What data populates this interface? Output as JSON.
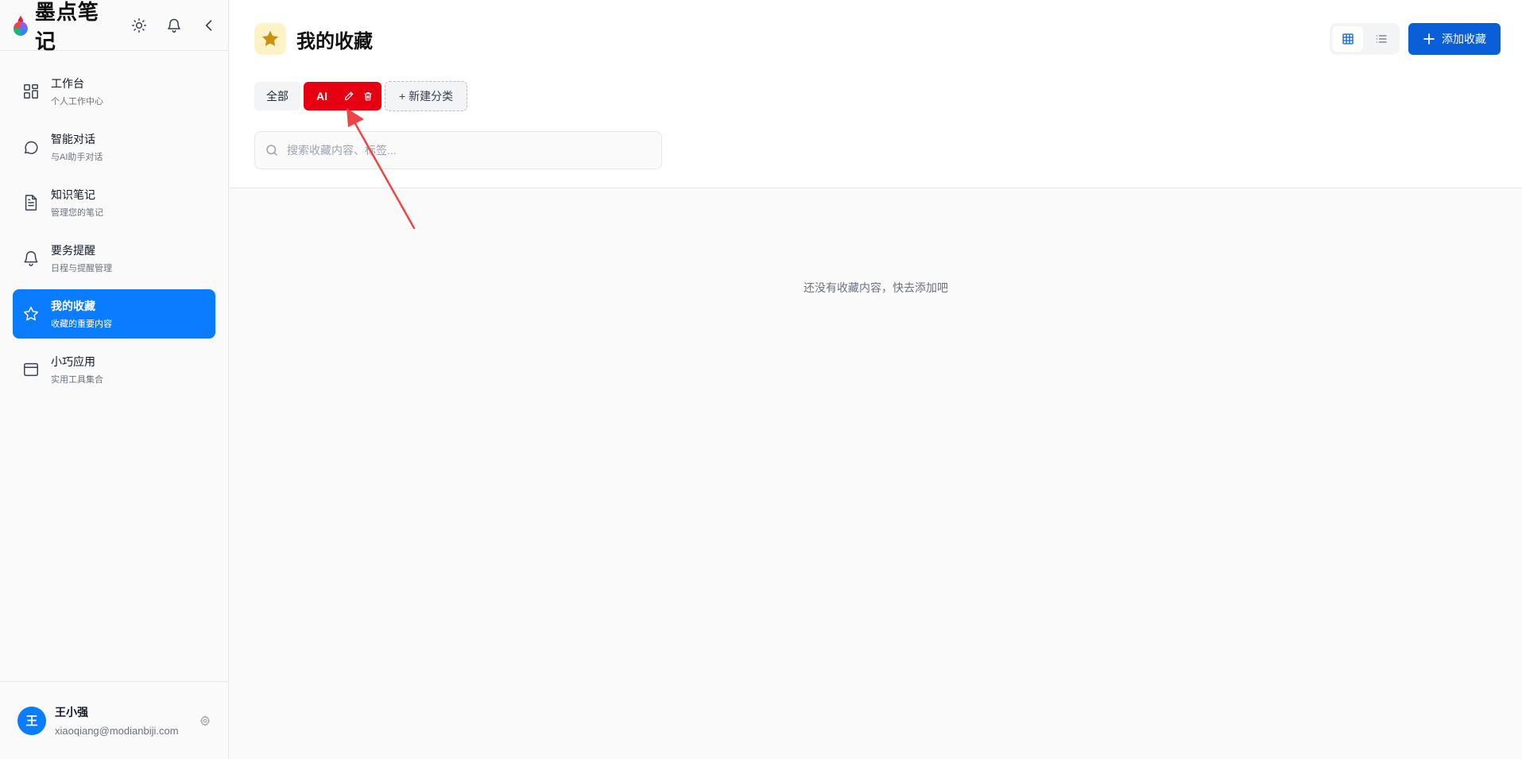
{
  "brand": {
    "name": "墨点笔记"
  },
  "nav": {
    "items": [
      {
        "title": "工作台",
        "sub": "个人工作中心",
        "icon": "dashboard-icon"
      },
      {
        "title": "智能对话",
        "sub": "与AI助手对话",
        "icon": "chat-bubble-icon"
      },
      {
        "title": "知识笔记",
        "sub": "管理您的笔记",
        "icon": "document-icon"
      },
      {
        "title": "要务提醒",
        "sub": "日程与提醒管理",
        "icon": "bell-icon"
      },
      {
        "title": "我的收藏",
        "sub": "收藏的重要内容",
        "icon": "star-icon",
        "active": true
      },
      {
        "title": "小巧应用",
        "sub": "实用工具集合",
        "icon": "app-window-icon"
      }
    ]
  },
  "user": {
    "avatar": "王",
    "name": "王小强",
    "email": "xiaoqiang@modianbiji.com"
  },
  "page": {
    "title": "我的收藏"
  },
  "toolbar": {
    "add_label": "添加收藏"
  },
  "categories": {
    "all_label": "全部",
    "items": [
      {
        "label": "AI"
      }
    ],
    "new_label": "+ 新建分类"
  },
  "search": {
    "placeholder": "搜索收藏内容、标签..."
  },
  "empty": {
    "text": "还没有收藏内容，快去添加吧"
  },
  "colors": {
    "primary": "#0a7cff",
    "add_button": "#0a5fd8",
    "category_active": "#e60012",
    "annotation_arrow": "#ef4444",
    "star": "#c8920e"
  }
}
